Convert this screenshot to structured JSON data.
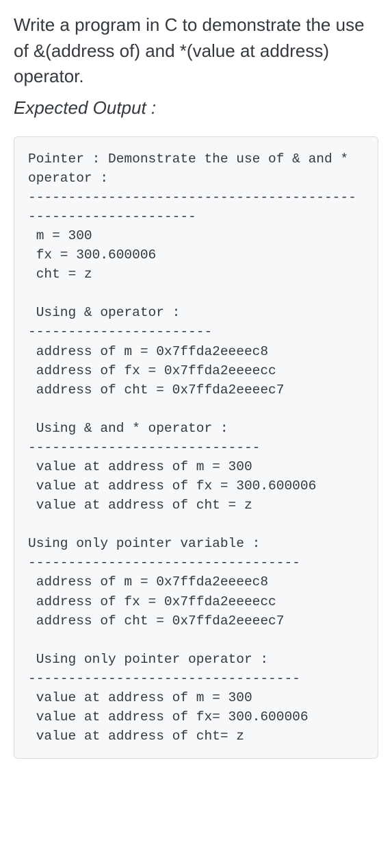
{
  "prompt_text": "Write a program in C to demonstrate the use of &(address of) and *(value at address) operator.",
  "expected_label": "Expected Output :",
  "code_output": "Pointer : Demonstrate the use of & and * operator :\n--------------------------------------------------------------\n m = 300\n fx = 300.600006\n cht = z\n\n Using & operator :\n-----------------------\n address of m = 0x7ffda2eeeec8\n address of fx = 0x7ffda2eeeecc\n address of cht = 0x7ffda2eeeec7\n\n Using & and * operator :\n-----------------------------\n value at address of m = 300\n value at address of fx = 300.600006\n value at address of cht = z\n\nUsing only pointer variable :\n----------------------------------\n address of m = 0x7ffda2eeeec8\n address of fx = 0x7ffda2eeeecc\n address of cht = 0x7ffda2eeeec7\n\n Using only pointer operator :\n----------------------------------\n value at address of m = 300\n value at address of fx= 300.600006\n value at address of cht= z"
}
